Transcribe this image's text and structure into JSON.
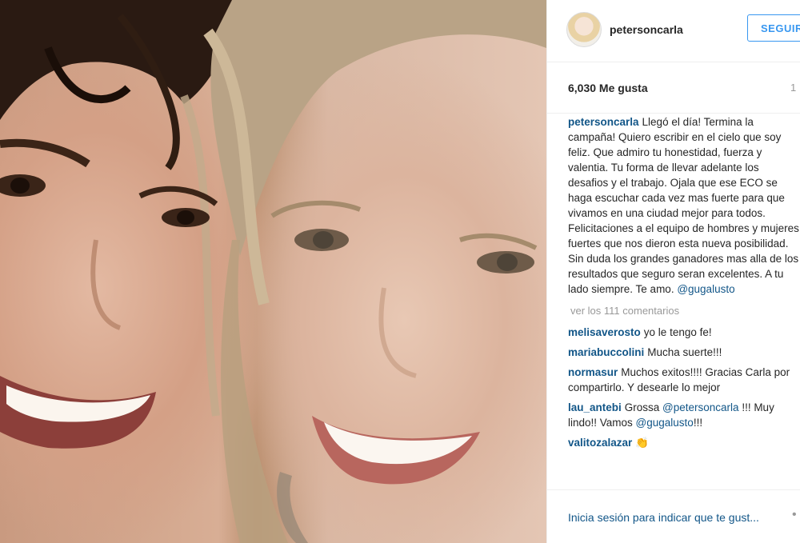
{
  "post": {
    "username": "petersoncarla",
    "follow_label": "SEGUIR",
    "likes": "6,030 Me gusta",
    "time_partial": "1",
    "caption_user": "petersoncarla",
    "caption_text": "Llegó el día! Termina la campaña! Quiero escribir en el cielo que soy feliz. Que admiro tu honestidad, fuerza y valentia. Tu forma de llevar adelante los desafios y el trabajo. Ojala que ese ECO se haga escuchar cada vez mas fuerte para que vivamos en una ciudad mejor para todos. Felicitaciones a el equipo de hombres y mujeres fuertes que nos dieron esta nueva posibilidad. Sin duda los grandes ganadores mas alla de los resultados que seguro seran excelentes. A tu lado siempre. Te amo. ",
    "caption_mention": "@gugalusto",
    "view_all": "ver los 111 comentarios"
  },
  "comments": [
    {
      "user": "melisaverosto",
      "text": "yo le tengo fe!"
    },
    {
      "user": "mariabuccolini",
      "text": "Mucha suerte!!!"
    },
    {
      "user": "normasur",
      "text": "Muchos exitos!!!! Gracias Carla por compartirlo. Y desearle lo mejor"
    },
    {
      "user": "lau_antebi",
      "text_before": "Grossa ",
      "mention1": "@petersoncarla",
      "text_mid": " !!! Muy lindo!! Vamos ",
      "mention2": "@gugalusto",
      "text_after": "!!!"
    },
    {
      "user": "valitozalazar",
      "text": "👏"
    }
  ],
  "login": {
    "text": "Inicia sesión para indicar que te gust...",
    "more": "•"
  },
  "colors": {
    "accent": "#3897f0",
    "username": "#125688",
    "muted": "#999999",
    "text": "#262626",
    "divider": "#efefef"
  }
}
